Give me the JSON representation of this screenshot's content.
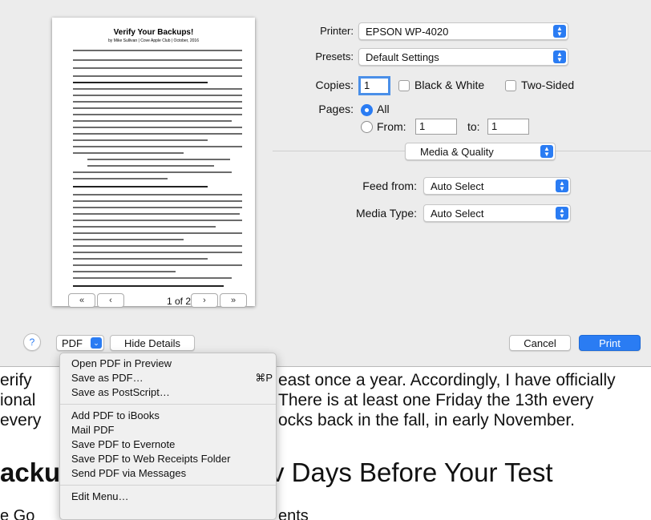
{
  "preview": {
    "doc_title": "Verify Your Backups!",
    "doc_byline": "by Mike Sullivan | Cove Apple Club | October, 2016",
    "page_label": "1 of 2",
    "first_btn": "«",
    "prev_btn": "‹",
    "next_btn": "›",
    "last_btn": "»"
  },
  "settings": {
    "printer_label": "Printer:",
    "printer_value": "EPSON WP-4020",
    "presets_label": "Presets:",
    "presets_value": "Default Settings",
    "copies_label": "Copies:",
    "copies_value": "1",
    "bw_label": "Black & White",
    "twosided_label": "Two-Sided",
    "pages_label": "Pages:",
    "pages_all": "All",
    "pages_from": "From:",
    "pages_from_value": "1",
    "pages_to": "to:",
    "pages_to_value": "1",
    "section_value": "Media & Quality",
    "feed_label": "Feed from:",
    "feed_value": "Auto Select",
    "media_label": "Media Type:",
    "media_value": "Auto Select"
  },
  "footer": {
    "help": "?",
    "pdf": "PDF",
    "hide_details": "Hide Details",
    "cancel": "Cancel",
    "print": "Print"
  },
  "pdf_menu": {
    "items": [
      "Open PDF in Preview",
      "Save as PDF…",
      "Save as PostScript…",
      "Add PDF to iBooks",
      "Mail PDF",
      "Save PDF to Evernote",
      "Save PDF to Web Receipts Folder",
      "Send PDF via Messages",
      "Edit Menu…"
    ],
    "shortcut": "⌘P"
  },
  "background_doc": {
    "line1_left": "erify",
    "line1_right": "east once a year. Accordingly, I have officially",
    "line2_left": "ional",
    "line2_right": "There is at least one Friday the 13th every",
    "line3_left": "every",
    "line3_right": "ocks back in the fall, in early November.",
    "heading_left": "acku",
    "heading_right": "v Days Before Your Test",
    "line5_left": "e Go",
    "line5_right": "ents"
  },
  "colors": {
    "accent": "#2a7cf3",
    "dialog_bg": "#ececec",
    "menu_bg": "#f0f0f0"
  }
}
